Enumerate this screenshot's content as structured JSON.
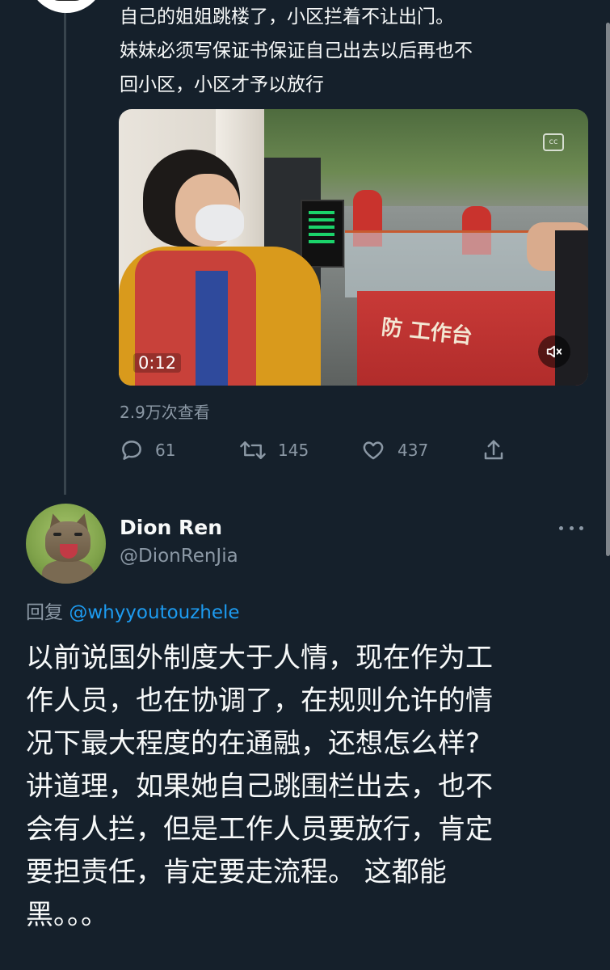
{
  "parent_tweet": {
    "text": "自己的姐姐跳楼了，小区拦着不让出门。\n妹妹必须写保证书保证自己出去以后再也不\n回小区，小区才予以放行",
    "video": {
      "time": "0:12",
      "booth_label": "防 工作台"
    },
    "views": "2.9万次查看",
    "actions": {
      "reply_count": "61",
      "retweet_count": "145",
      "like_count": "437"
    }
  },
  "reply_tweet": {
    "display_name": "Dion Ren",
    "handle": "@DionRenJia",
    "replying_prefix": "回复 ",
    "replying_mention": "@whyyoutouzhele",
    "text": "以前说国外制度大于人情，现在作为工\n作人员，也在协调了，在规则允许的情\n况下最大程度的在通融，还想怎么样?\n讲道理，如果她自己跳围栏出去，也不\n会有人拦，但是工作人员要放行，肯定\n要担责任，肯定要走流程。 这都能\n黑。。。"
  },
  "colors": {
    "background": "#15202b",
    "text_primary": "#f7f9f9",
    "text_secondary": "#8b98a5",
    "accent": "#1d9bf0"
  },
  "icons": [
    "reply-icon",
    "retweet-icon",
    "like-icon",
    "share-icon",
    "mute-icon",
    "captions-icon",
    "more-icon"
  ]
}
